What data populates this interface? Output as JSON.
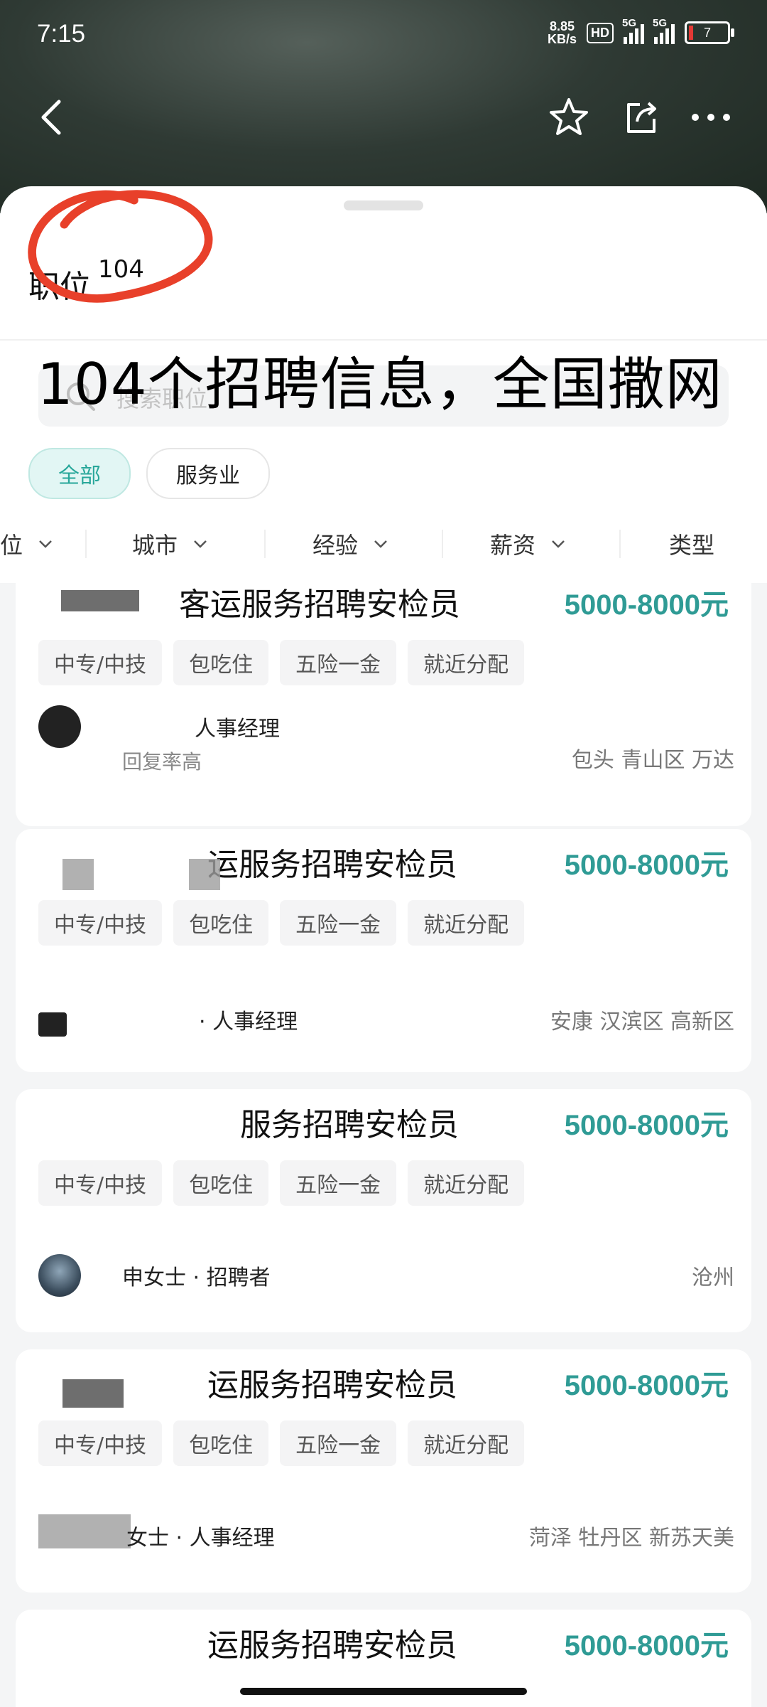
{
  "status_bar": {
    "time": "7:15",
    "net_speed_value": "8.85",
    "net_speed_unit": "KB/s",
    "hd_badge": "HD",
    "signal1_label": "5G",
    "signal2_label": "5G",
    "battery_level": "7"
  },
  "nav": {
    "back_icon": "back-arrow-icon",
    "actions": [
      "star-icon",
      "share-icon",
      "more-icon"
    ]
  },
  "header": {
    "title": "职位",
    "count": "104",
    "overlay_caption": "104个招聘信息，全国撒网"
  },
  "search": {
    "placeholder": "搜索职位"
  },
  "chips": [
    {
      "label": "全部",
      "active": true
    },
    {
      "label": "服务业",
      "active": false
    }
  ],
  "filters": [
    "位",
    "城市",
    "经验",
    "薪资",
    "类型"
  ],
  "jobs": [
    {
      "title": "客运服务招聘安检员",
      "salary": "5000-8000元",
      "tags": [
        "中专/中技",
        "包吃住",
        "五险一金",
        "就近分配"
      ],
      "recruiter": "人事经理",
      "recruiter_sub": "回复率高",
      "location": "包头  青山区  万达"
    },
    {
      "title": "运服务招聘安检员",
      "salary": "5000-8000元",
      "tags": [
        "中专/中技",
        "包吃住",
        "五险一金",
        "就近分配"
      ],
      "recruiter": "· 人事经理",
      "recruiter_sub": "",
      "location": "安康  汉滨区  高新区"
    },
    {
      "title": "服务招聘安检员",
      "salary": "5000-8000元",
      "tags": [
        "中专/中技",
        "包吃住",
        "五险一金",
        "就近分配"
      ],
      "recruiter": "申女士 · 招聘者",
      "recruiter_sub": "",
      "location": "沧州"
    },
    {
      "title": "运服务招聘安检员",
      "salary": "5000-8000元",
      "tags": [
        "中专/中技",
        "包吃住",
        "五险一金",
        "就近分配"
      ],
      "recruiter": "女士 · 人事经理",
      "recruiter_sub": "",
      "location": "菏泽  牡丹区  新苏天美"
    },
    {
      "title": "运服务招聘安检员",
      "salary": "5000-8000元"
    }
  ],
  "colors": {
    "accent": "#2f9b95",
    "chip_active_bg": "#e2f6f4",
    "annotation_red": "#e8402a"
  }
}
